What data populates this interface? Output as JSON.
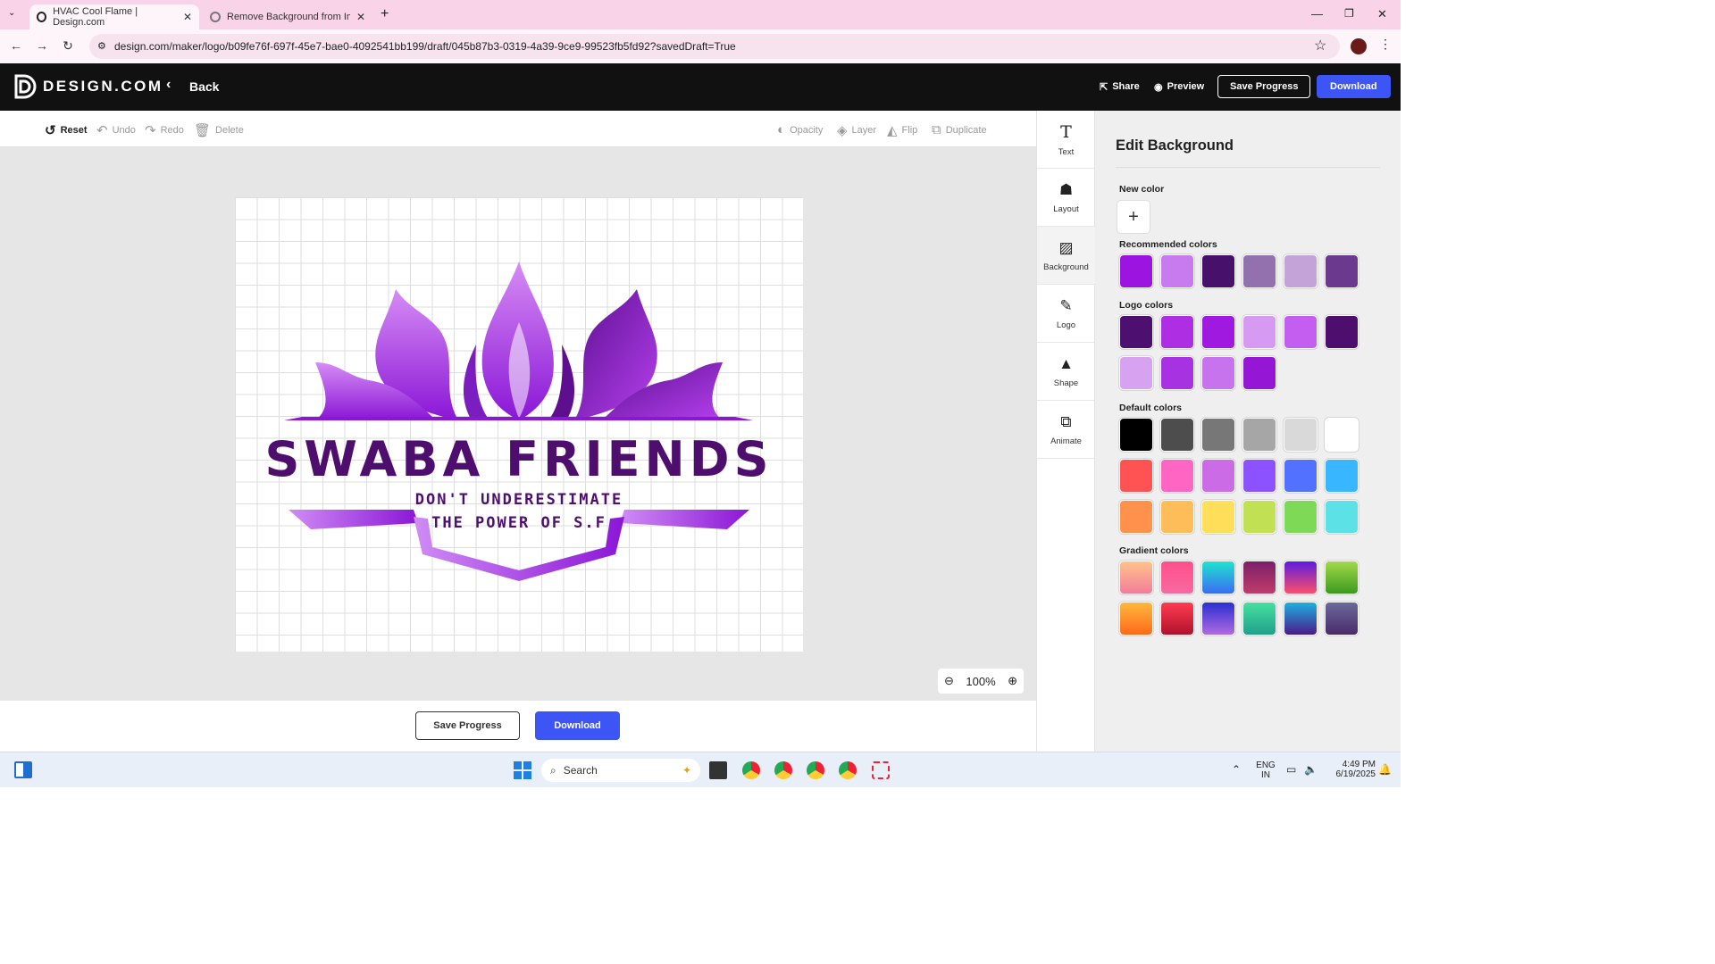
{
  "browser": {
    "tabs": [
      {
        "title": "HVAC Cool Flame | Design.com",
        "active": true
      },
      {
        "title": "Remove Background from Imag",
        "active": false
      }
    ],
    "url": "design.com/maker/logo/b09fe76f-697f-45e7-bae0-4092541bb199/draft/045b87b3-0319-4a39-9ce9-99523fb5fd92?savedDraft=True"
  },
  "header": {
    "brand": "DESIGN.COM",
    "back_label": "Back",
    "share_label": "Share",
    "preview_label": "Preview",
    "save_label": "Save Progress",
    "download_label": "Download"
  },
  "toolbar": {
    "reset": "Reset",
    "undo": "Undo",
    "redo": "Redo",
    "delete": "Delete",
    "opacity": "Opacity",
    "layer": "Layer",
    "flip": "Flip",
    "duplicate": "Duplicate"
  },
  "logo": {
    "title": "SWABA FRIENDS",
    "tagline_line1": "DON'T UNDERESTIMATE",
    "tagline_line2": "THE POWER OF S.F"
  },
  "canvas": {
    "zoom": "100%",
    "save_label": "Save Progress",
    "download_label": "Download"
  },
  "sidenav": {
    "items": [
      {
        "label": "Text",
        "icon": "text-icon"
      },
      {
        "label": "Layout",
        "icon": "layout-icon"
      },
      {
        "label": "Background",
        "icon": "background-icon",
        "active": true
      },
      {
        "label": "Logo",
        "icon": "logo-icon"
      },
      {
        "label": "Shape",
        "icon": "shape-icon"
      },
      {
        "label": "Animate",
        "icon": "animate-icon"
      }
    ]
  },
  "panel": {
    "title": "Edit Background",
    "new_color_label": "New color",
    "recommended_label": "Recommended colors",
    "recommended": [
      "#9b14e0",
      "#c77bee",
      "#47106a",
      "#9370ae",
      "#c3a3d8",
      "#6b3a8f"
    ],
    "logo_label": "Logo colors",
    "logo_colors": [
      "#4e1070",
      "#ad2ee3",
      "#9f19e0",
      "#d69af2",
      "#c35ef0",
      "#4e0e6e",
      "#d7a3f1",
      "#a632e2",
      "#c873ee",
      "#9616d6"
    ],
    "default_label": "Default colors",
    "default_colors": [
      "#000000",
      "#4d4d4d",
      "#777777",
      "#a6a6a6",
      "#d9d9d9",
      "#ffffff",
      "#ff5252",
      "#ff66c4",
      "#cb6ce6",
      "#8c52ff",
      "#5271ff",
      "#38b6ff",
      "#ff914d",
      "#ffbd59",
      "#ffde59",
      "#c1e054",
      "#7ed957",
      "#5ce1e6"
    ],
    "gradient_label": "Gradient colors",
    "gradients": [
      [
        "#ffc48a",
        "#f27c9a"
      ],
      [
        "#ff4f8b",
        "#f76aa0"
      ],
      [
        "#1fe3cf",
        "#3b6cf5"
      ],
      [
        "#7a1f6a",
        "#c03d6a"
      ],
      [
        "#5a1ce0",
        "#ff4f6a"
      ],
      [
        "#a3d94a",
        "#3b9a1f"
      ],
      [
        "#ffb73d",
        "#ff6a1a"
      ],
      [
        "#ff3b4f",
        "#b0122e"
      ],
      [
        "#2a2fd0",
        "#b06ae0"
      ],
      [
        "#47e0a0",
        "#1fa08a"
      ],
      [
        "#1fb0e0",
        "#4a1a8a"
      ],
      [
        "#6a6a9a",
        "#4a2a6a"
      ]
    ]
  },
  "taskbar": {
    "search_placeholder": "Search",
    "lang1": "ENG",
    "lang2": "IN",
    "time": "4:49 PM",
    "date": "6/19/2025"
  }
}
